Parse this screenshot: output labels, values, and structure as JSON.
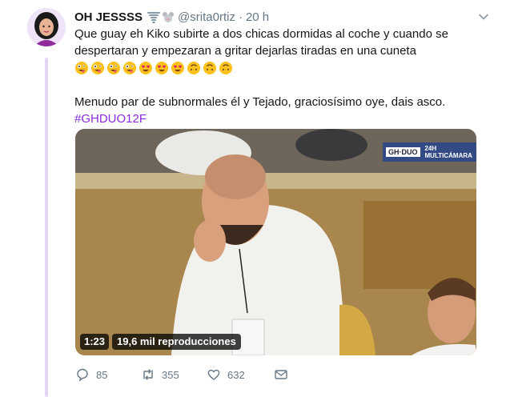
{
  "tweet": {
    "display_name": "OH JESSSS",
    "handle": "@srita0rtiz",
    "separator": "·",
    "time": "20 h",
    "badges": [
      "tornado-emoji",
      "mouse-emoji"
    ],
    "line1": "Que guay eh Kiko subirte a dos chicas dormidas al coche y cuando se",
    "line2": "despertaran y empezaran a gritar dejarlas tiradas en una cuneta",
    "emojis": [
      "zany-face",
      "zany-face",
      "zany-face",
      "zany-face",
      "heart-eyes",
      "heart-eyes",
      "heart-eyes",
      "upside-down-face",
      "upside-down-face",
      "upside-down-face"
    ],
    "para2": "Menudo par de subnormales él y Tejado, graciosísimo oye, dais asco.",
    "hashtag": "#GHDUO12F"
  },
  "video": {
    "duration": "1:23",
    "views": "19,6 mil reproducciones",
    "overlay_logo": "GH·DUO",
    "overlay_text": "24H MULTICÁMARA"
  },
  "actions": {
    "replies": "85",
    "retweets": "355",
    "likes": "632"
  },
  "colors": {
    "hashtag": "#8a2be2",
    "muted": "#657786",
    "thread_line": "#e4d4f5"
  }
}
